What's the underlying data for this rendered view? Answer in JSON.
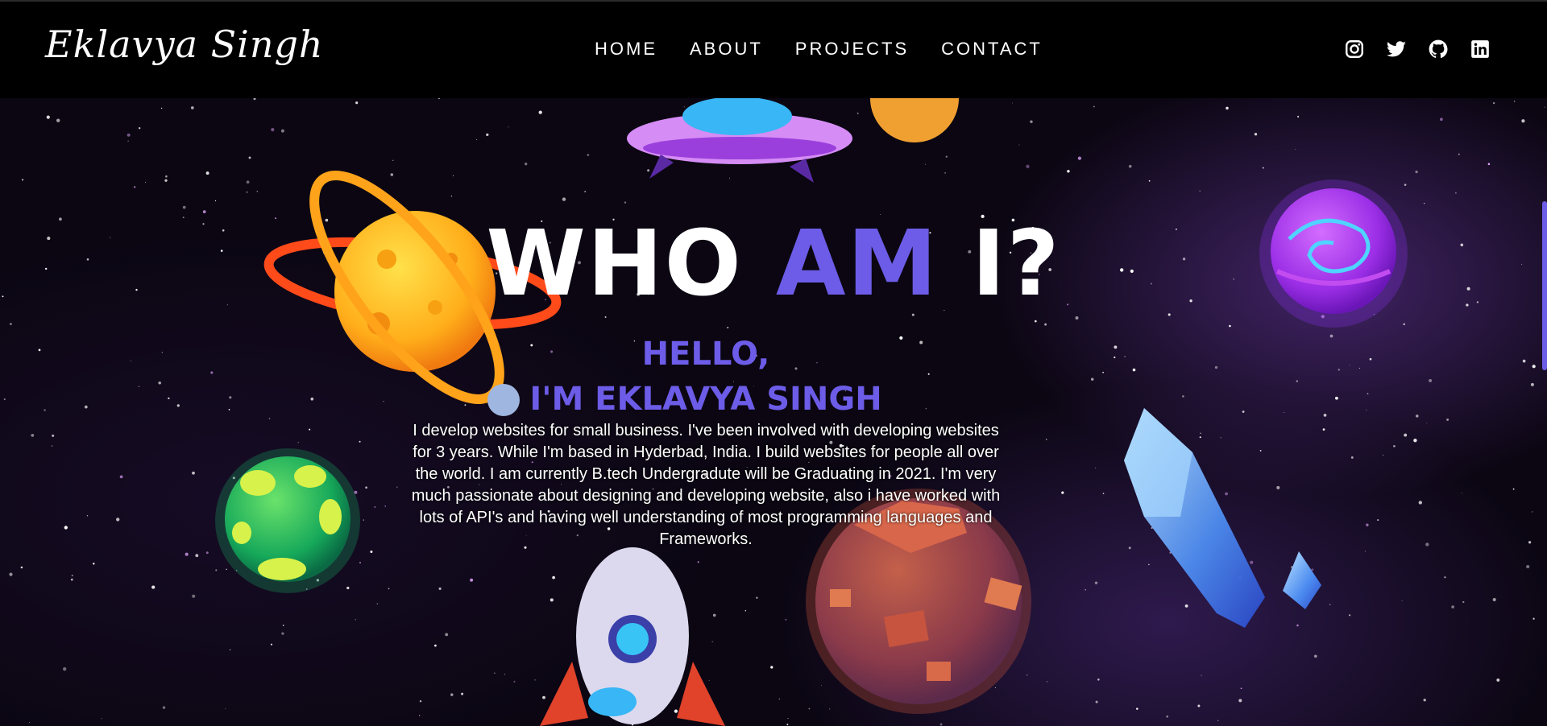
{
  "brand": {
    "name": "Eklavya Singh"
  },
  "nav": {
    "items": [
      {
        "label": "HOME"
      },
      {
        "label": "ABOUT"
      },
      {
        "label": "PROJECTS"
      },
      {
        "label": "CONTACT"
      }
    ]
  },
  "socials": [
    {
      "icon": "instagram-icon"
    },
    {
      "icon": "twitter-icon"
    },
    {
      "icon": "github-icon"
    },
    {
      "icon": "linkedin-icon"
    }
  ],
  "hero": {
    "title_part1": "WHO",
    "title_accent": "AM",
    "title_part2": "I?",
    "hello": "HELLO,",
    "name": "I'M EKLAVYA SINGH",
    "bio": "I develop websites for small business. I've been involved with developing websites for 3 years. While I'm based in Hyderbad, India. I build websites for people all over the world. I am currently B.tech Undergradute will be Graduating in 2021. I'm very much passionate about designing and developing website, also i have worked with lots of API's and having well understanding of most programming languages and Frameworks."
  },
  "colors": {
    "accent": "#6c5ce7",
    "navbar_bg": "#000000",
    "text": "#ffffff"
  }
}
